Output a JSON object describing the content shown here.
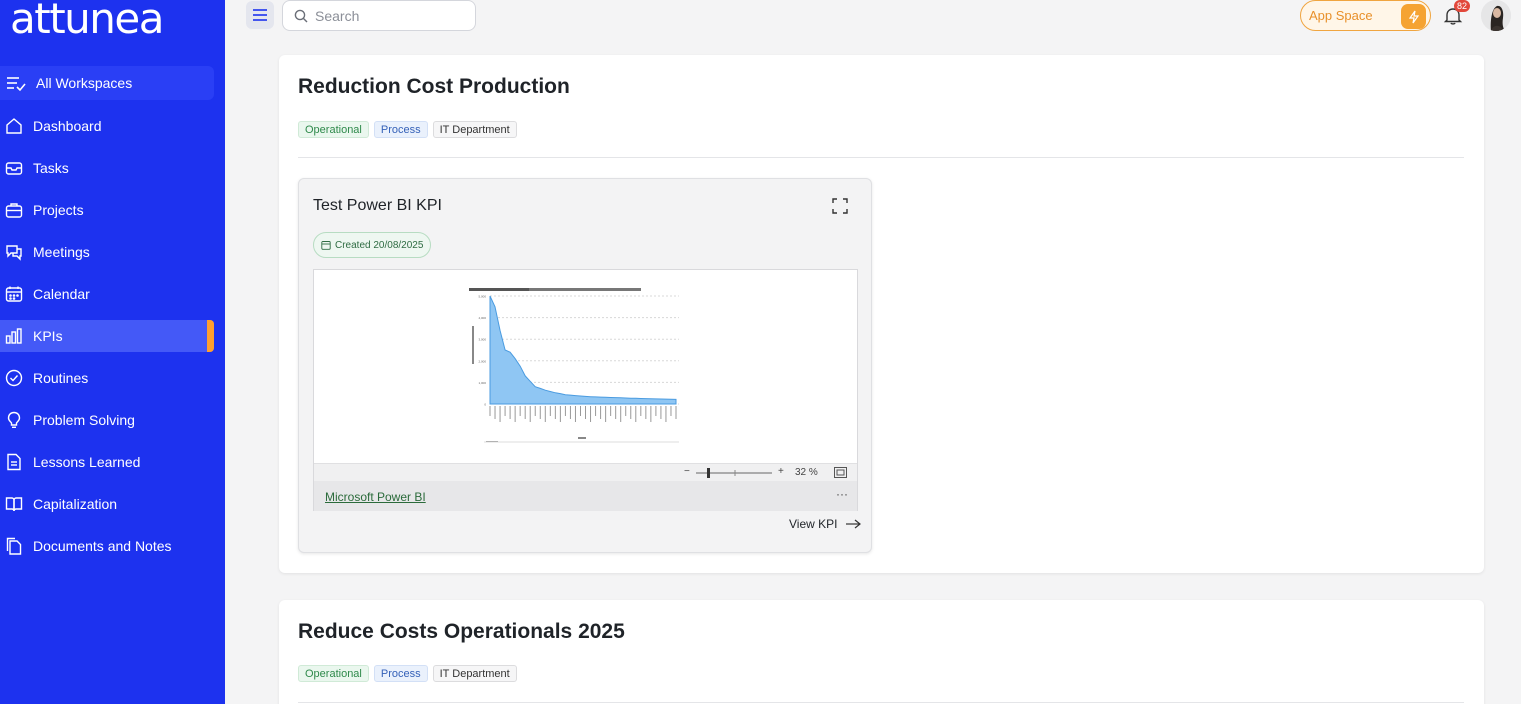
{
  "brand": {
    "logo": "attunea"
  },
  "workspace": {
    "label": "All Workspaces"
  },
  "sidebar": {
    "items": [
      {
        "label": "Dashboard",
        "icon": "home-icon"
      },
      {
        "label": "Tasks",
        "icon": "inbox-icon"
      },
      {
        "label": "Projects",
        "icon": "briefcase-icon"
      },
      {
        "label": "Meetings",
        "icon": "chat-icon"
      },
      {
        "label": "Calendar",
        "icon": "calendar-icon"
      },
      {
        "label": "KPIs",
        "icon": "bar-chart-icon",
        "active": true
      },
      {
        "label": "Routines",
        "icon": "check-circle-icon"
      },
      {
        "label": "Problem Solving",
        "icon": "lightbulb-icon"
      },
      {
        "label": "Lessons Learned",
        "icon": "document-icon"
      },
      {
        "label": "Capitalization",
        "icon": "book-icon"
      },
      {
        "label": "Documents and Notes",
        "icon": "files-icon"
      }
    ]
  },
  "topbar": {
    "search_placeholder": "Search",
    "app_space_label": "App Space",
    "notification_count": "82"
  },
  "colors": {
    "sidebar": "#1d32ef",
    "accent": "#ff9f2e",
    "active_item": "#4459f7"
  },
  "objectives": [
    {
      "title": "Reduction Cost Production",
      "tags": [
        "Operational",
        "Process",
        "IT Department"
      ],
      "kpi": {
        "title": "Test Power BI KPI",
        "created": "Created 20/08/2025",
        "zoom": "32 %",
        "zoom_level": 0.32,
        "source_link": "Microsoft Power BI",
        "more": "···",
        "view_label": "View KPI"
      }
    },
    {
      "title": "Reduce Costs Operationals 2025",
      "tags": [
        "Operational",
        "Process",
        "IT Department"
      ]
    }
  ],
  "chart_data": {
    "type": "area",
    "values": [
      5000,
      4500,
      3400,
      2500,
      2400,
      2100,
      1750,
      1300,
      1050,
      800,
      720,
      640,
      580,
      520,
      480,
      430,
      410,
      390,
      370,
      350,
      340,
      330,
      320,
      310,
      300,
      295,
      290,
      280,
      270,
      265,
      255,
      250,
      240,
      235,
      230,
      225,
      220,
      215
    ],
    "yticks": [
      "0",
      "1,000",
      "2,000",
      "3,000",
      "4,000",
      "5,000"
    ],
    "ylim": [
      0,
      5000
    ],
    "grid": true
  }
}
